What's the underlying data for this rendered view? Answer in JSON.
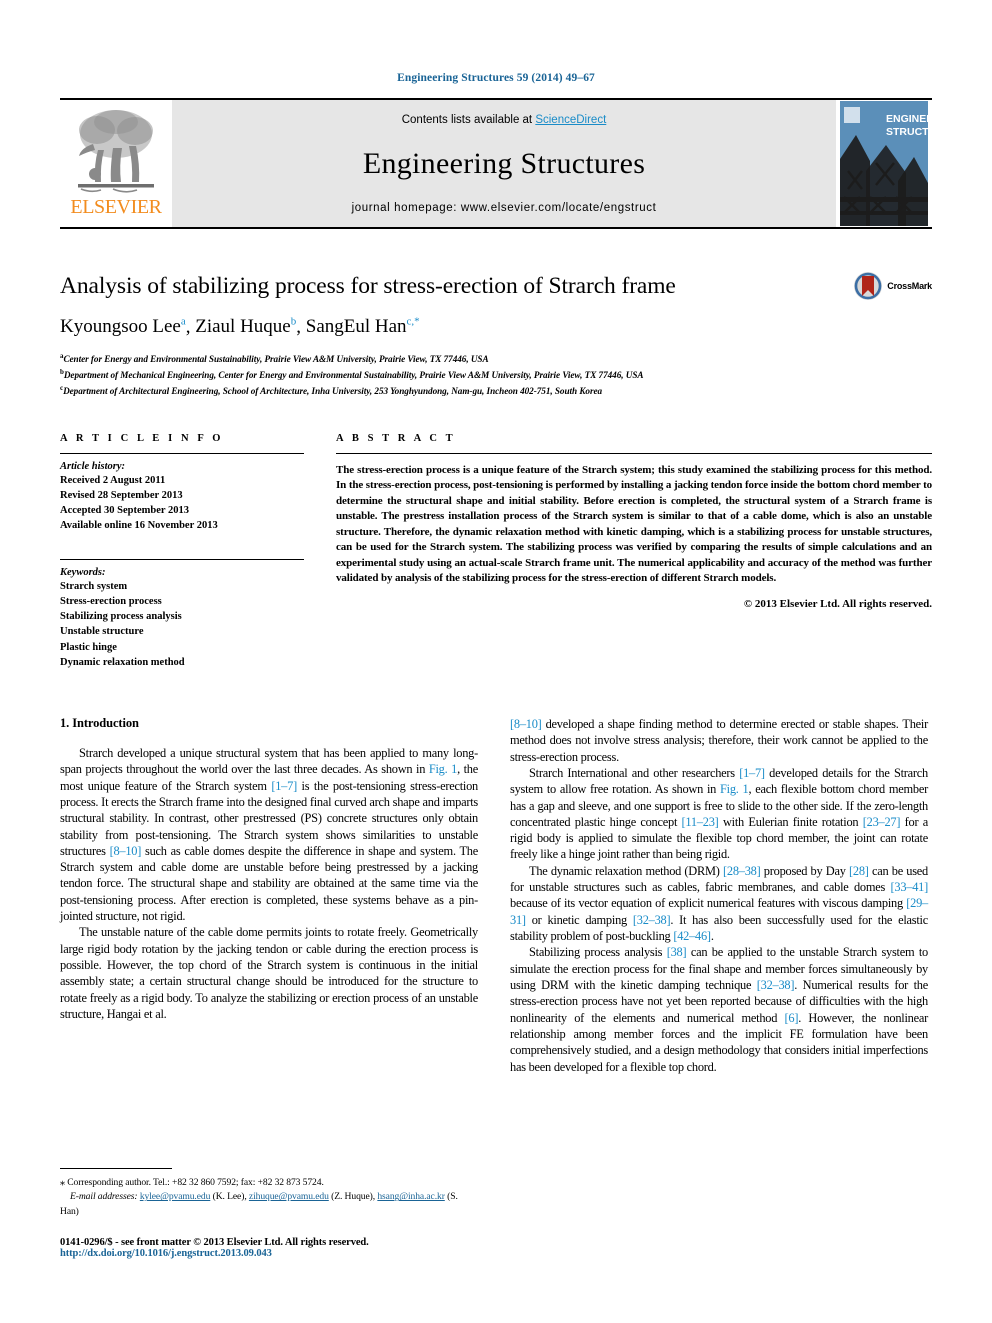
{
  "running_head": "Engineering Structures 59 (2014) 49–67",
  "masthead": {
    "contents_prefix": "Contents lists available at ",
    "sciencedirect": "ScienceDirect",
    "journal_name": "Engineering Structures",
    "homepage": "journal homepage: www.elsevier.com/locate/engstruct",
    "publisher_word": "ELSEVIER",
    "cover_title_line1": "ENGINEERING",
    "cover_title_line2": "STRUCTURES",
    "colors": {
      "link_blue": "#1a8cc8",
      "running_head_blue": "#1a6496",
      "elsevier_orange": "#F28C1E",
      "masthead_grey": "#e6e6e6",
      "cover_blue": "#5b8fb9"
    }
  },
  "title_block": {
    "title": "Analysis of stabilizing process for stress-erection of Strarch frame",
    "authors": [
      {
        "name": "Kyoungsoo Lee",
        "sup": "a"
      },
      {
        "name": "Ziaul Huque",
        "sup": "b"
      },
      {
        "name": "SangEul Han",
        "sup": "c,*"
      }
    ],
    "affiliations": [
      {
        "sup": "a",
        "text": "Center for Energy and Environmental Sustainability, Prairie View A&M University, Prairie View, TX 77446, USA"
      },
      {
        "sup": "b",
        "text": "Department of Mechanical Engineering, Center for Energy and Environmental Sustainability, Prairie View A&M University, Prairie View, TX 77446, USA"
      },
      {
        "sup": "c",
        "text": "Department of Architectural Engineering, School of Architecture, Inha University, 253 Yonghyundong, Nam-gu, Incheon 402-751, South Korea"
      }
    ],
    "crossmark_label": "CrossMark"
  },
  "article_info": {
    "heading": "A R T I C L E   I N F O",
    "history_title": "Article history:",
    "history": [
      "Received 2 August 2011",
      "Revised 28 September 2013",
      "Accepted 30 September 2013",
      "Available online 16 November 2013"
    ],
    "keywords_title": "Keywords:",
    "keywords": [
      "Strarch system",
      "Stress-erection process",
      "Stabilizing process analysis",
      "Unstable structure",
      "Plastic hinge",
      "Dynamic relaxation method"
    ]
  },
  "abstract": {
    "heading": "A B S T R A C T",
    "text": "The stress-erection process is a unique feature of the Strarch system; this study examined the stabilizing process for this method. In the stress-erection process, post-tensioning is performed by installing a jacking tendon force inside the bottom chord member to determine the structural shape and initial stability. Before erection is completed, the structural system of a Strarch frame is unstable. The prestress installation process of the Strarch system is similar to that of a cable dome, which is also an unstable structure. Therefore, the dynamic relaxation method with kinetic damping, which is a stabilizing process for unstable structures, can be used for the Strarch system. The stabilizing process was verified by comparing the results of simple calculations and an experimental study using an actual-scale Strarch frame unit. The numerical applicability and accuracy of the method was further validated by analysis of the stabilizing process for the stress-erection of different Strarch models.",
    "copyright": "© 2013 Elsevier Ltd. All rights reserved."
  },
  "body": {
    "section_title": "1. Introduction",
    "left_paragraphs": [
      {
        "parts": [
          {
            "t": "Strarch developed a unique structural system that has been applied to many long-span projects throughout the world over the last three decades. As shown in "
          },
          {
            "t": "Fig. 1",
            "ref": true
          },
          {
            "t": ", the most unique feature of the Strarch system "
          },
          {
            "t": "[1–7]",
            "ref": true
          },
          {
            "t": " is the post-tensioning stress-erection process. It erects the Strarch frame into the designed final curved arch shape and imparts structural stability. In contrast, other prestressed (PS) concrete structures only obtain stability from post-tensioning. The Strarch system shows similarities to unstable structures "
          },
          {
            "t": "[8–10]",
            "ref": true
          },
          {
            "t": " such as cable domes despite the difference in shape and system. The Strarch system and cable dome are unstable before being prestressed by a jacking tendon force. The structural shape and stability are obtained at the same time via the post-tensioning process. After erection is completed, these systems behave as a pin-jointed structure, not rigid."
          }
        ]
      },
      {
        "parts": [
          {
            "t": "The unstable nature of the cable dome permits joints to rotate freely. Geometrically large rigid body rotation by the jacking tendon or cable during the erection process is possible. However, the top chord of the Strarch system is continuous in the initial assembly state; a certain structural change should be introduced for the structure to rotate freely as a rigid body. To analyze the stabilizing or erection process of an unstable structure, Hangai et al."
          }
        ]
      }
    ],
    "right_paragraphs": [
      {
        "no_indent": true,
        "parts": [
          {
            "t": "[8–10]",
            "ref": true
          },
          {
            "t": " developed a shape finding method to determine erected or stable shapes. Their method does not involve stress analysis; therefore, their work cannot be applied to the stress-erection process."
          }
        ]
      },
      {
        "parts": [
          {
            "t": "Strarch International and other researchers "
          },
          {
            "t": "[1–7]",
            "ref": true
          },
          {
            "t": " developed details for the Strarch system to allow free rotation. As shown in "
          },
          {
            "t": "Fig. 1",
            "ref": true
          },
          {
            "t": ", each flexible bottom chord member has a gap and sleeve, and one support is free to slide to the other side. If the zero-length concentrated plastic hinge concept "
          },
          {
            "t": "[11–23]",
            "ref": true
          },
          {
            "t": " with Eulerian finite rotation "
          },
          {
            "t": "[23–27]",
            "ref": true
          },
          {
            "t": " for a rigid body is applied to simulate the flexible top chord member, the joint can rotate freely like a hinge joint rather than being rigid."
          }
        ]
      },
      {
        "parts": [
          {
            "t": "The dynamic relaxation method (DRM) "
          },
          {
            "t": "[28–38]",
            "ref": true
          },
          {
            "t": " proposed by Day "
          },
          {
            "t": "[28]",
            "ref": true
          },
          {
            "t": " can be used for unstable structures such as cables, fabric membranes, and cable domes "
          },
          {
            "t": "[33–41]",
            "ref": true
          },
          {
            "t": " because of its vector equation of explicit numerical features with viscous damping "
          },
          {
            "t": "[29–31]",
            "ref": true
          },
          {
            "t": " or kinetic damping "
          },
          {
            "t": "[32–38]",
            "ref": true
          },
          {
            "t": ". It has also been successfully used for the elastic stability problem of post-buckling "
          },
          {
            "t": "[42–46]",
            "ref": true
          },
          {
            "t": "."
          }
        ]
      },
      {
        "parts": [
          {
            "t": "Stabilizing process analysis "
          },
          {
            "t": "[38]",
            "ref": true
          },
          {
            "t": " can be applied to the unstable Strarch system to simulate the erection process for the final shape and member forces simultaneously by using DRM with the kinetic damping technique "
          },
          {
            "t": "[32–38]",
            "ref": true
          },
          {
            "t": ". Numerical results for the stress-erection process have not yet been reported because of difficulties with the high nonlinearity of the elements and numerical method "
          },
          {
            "t": "[6]",
            "ref": true
          },
          {
            "t": ". However, the nonlinear relationship among member forces and the implicit FE formulation have been comprehensively studied, and a design methodology that considers initial imperfections has been developed for a flexible top chord."
          }
        ]
      }
    ]
  },
  "footnotes": {
    "corresponding": "Corresponding author. Tel.: +82 32 860 7592; fax: +82 32 873 5724.",
    "email_label": "E-mail addresses:",
    "emails": [
      {
        "address": "kylee@pvamu.edu",
        "owner": "(K. Lee)"
      },
      {
        "address": "zihuque@pvamu.edu",
        "owner": "(Z. Huque)"
      },
      {
        "address": "hsang@inha.ac.kr",
        "owner": "(S. Han)"
      }
    ]
  },
  "colophon": {
    "line1": "0141-0296/$ - see front matter © 2013 Elsevier Ltd. All rights reserved.",
    "line2": "http://dx.doi.org/10.1016/j.engstruct.2013.09.043"
  }
}
